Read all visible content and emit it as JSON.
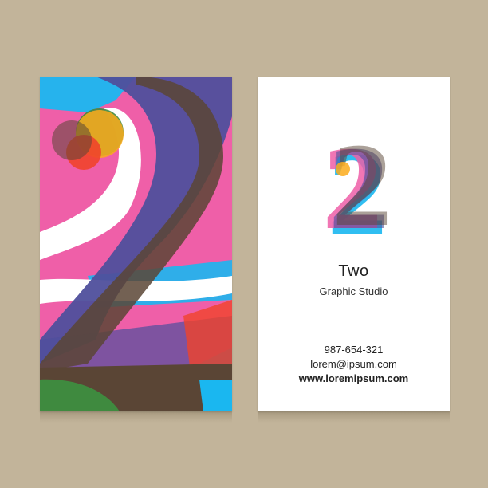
{
  "colors": {
    "background": "#c2b49a",
    "blue": "#4f4f9c",
    "pink": "#ef5fa8",
    "cyan": "#1ab7f0",
    "orange": "#fbac1c",
    "red": "#f0442b",
    "green": "#3f8a3f",
    "brown": "#5a4535"
  },
  "card_back": {
    "logo_glyph": "2",
    "company_name": "Two",
    "tagline": "Graphic Studio",
    "phone": "987-654-321",
    "email": "lorem@ipsum.com",
    "website": "www.loremipsum.com"
  }
}
